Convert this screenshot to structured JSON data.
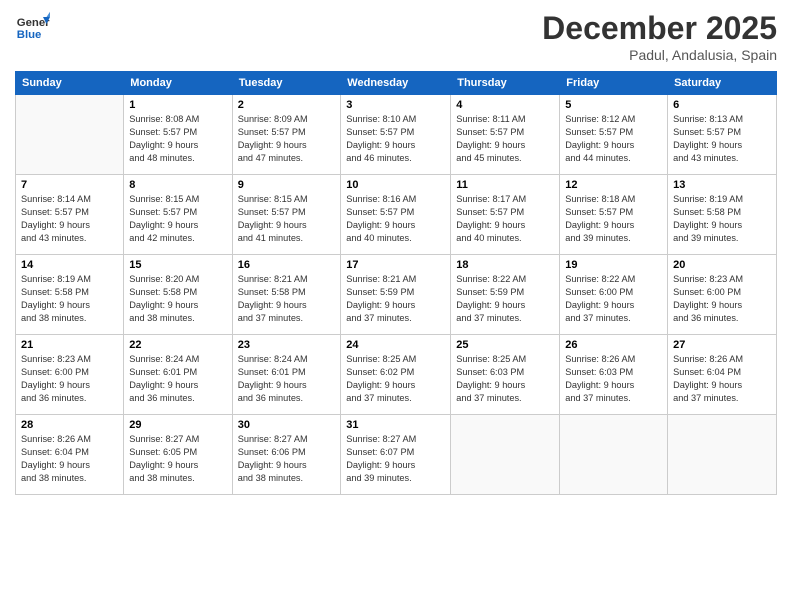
{
  "header": {
    "logo_general": "General",
    "logo_blue": "Blue",
    "month": "December 2025",
    "location": "Padul, Andalusia, Spain"
  },
  "weekdays": [
    "Sunday",
    "Monday",
    "Tuesday",
    "Wednesday",
    "Thursday",
    "Friday",
    "Saturday"
  ],
  "weeks": [
    [
      {
        "day": "",
        "info": ""
      },
      {
        "day": "1",
        "info": "Sunrise: 8:08 AM\nSunset: 5:57 PM\nDaylight: 9 hours\nand 48 minutes."
      },
      {
        "day": "2",
        "info": "Sunrise: 8:09 AM\nSunset: 5:57 PM\nDaylight: 9 hours\nand 47 minutes."
      },
      {
        "day": "3",
        "info": "Sunrise: 8:10 AM\nSunset: 5:57 PM\nDaylight: 9 hours\nand 46 minutes."
      },
      {
        "day": "4",
        "info": "Sunrise: 8:11 AM\nSunset: 5:57 PM\nDaylight: 9 hours\nand 45 minutes."
      },
      {
        "day": "5",
        "info": "Sunrise: 8:12 AM\nSunset: 5:57 PM\nDaylight: 9 hours\nand 44 minutes."
      },
      {
        "day": "6",
        "info": "Sunrise: 8:13 AM\nSunset: 5:57 PM\nDaylight: 9 hours\nand 43 minutes."
      }
    ],
    [
      {
        "day": "7",
        "info": "Sunrise: 8:14 AM\nSunset: 5:57 PM\nDaylight: 9 hours\nand 43 minutes."
      },
      {
        "day": "8",
        "info": "Sunrise: 8:15 AM\nSunset: 5:57 PM\nDaylight: 9 hours\nand 42 minutes."
      },
      {
        "day": "9",
        "info": "Sunrise: 8:15 AM\nSunset: 5:57 PM\nDaylight: 9 hours\nand 41 minutes."
      },
      {
        "day": "10",
        "info": "Sunrise: 8:16 AM\nSunset: 5:57 PM\nDaylight: 9 hours\nand 40 minutes."
      },
      {
        "day": "11",
        "info": "Sunrise: 8:17 AM\nSunset: 5:57 PM\nDaylight: 9 hours\nand 40 minutes."
      },
      {
        "day": "12",
        "info": "Sunrise: 8:18 AM\nSunset: 5:57 PM\nDaylight: 9 hours\nand 39 minutes."
      },
      {
        "day": "13",
        "info": "Sunrise: 8:19 AM\nSunset: 5:58 PM\nDaylight: 9 hours\nand 39 minutes."
      }
    ],
    [
      {
        "day": "14",
        "info": "Sunrise: 8:19 AM\nSunset: 5:58 PM\nDaylight: 9 hours\nand 38 minutes."
      },
      {
        "day": "15",
        "info": "Sunrise: 8:20 AM\nSunset: 5:58 PM\nDaylight: 9 hours\nand 38 minutes."
      },
      {
        "day": "16",
        "info": "Sunrise: 8:21 AM\nSunset: 5:58 PM\nDaylight: 9 hours\nand 37 minutes."
      },
      {
        "day": "17",
        "info": "Sunrise: 8:21 AM\nSunset: 5:59 PM\nDaylight: 9 hours\nand 37 minutes."
      },
      {
        "day": "18",
        "info": "Sunrise: 8:22 AM\nSunset: 5:59 PM\nDaylight: 9 hours\nand 37 minutes."
      },
      {
        "day": "19",
        "info": "Sunrise: 8:22 AM\nSunset: 6:00 PM\nDaylight: 9 hours\nand 37 minutes."
      },
      {
        "day": "20",
        "info": "Sunrise: 8:23 AM\nSunset: 6:00 PM\nDaylight: 9 hours\nand 36 minutes."
      }
    ],
    [
      {
        "day": "21",
        "info": "Sunrise: 8:23 AM\nSunset: 6:00 PM\nDaylight: 9 hours\nand 36 minutes."
      },
      {
        "day": "22",
        "info": "Sunrise: 8:24 AM\nSunset: 6:01 PM\nDaylight: 9 hours\nand 36 minutes."
      },
      {
        "day": "23",
        "info": "Sunrise: 8:24 AM\nSunset: 6:01 PM\nDaylight: 9 hours\nand 36 minutes."
      },
      {
        "day": "24",
        "info": "Sunrise: 8:25 AM\nSunset: 6:02 PM\nDaylight: 9 hours\nand 37 minutes."
      },
      {
        "day": "25",
        "info": "Sunrise: 8:25 AM\nSunset: 6:03 PM\nDaylight: 9 hours\nand 37 minutes."
      },
      {
        "day": "26",
        "info": "Sunrise: 8:26 AM\nSunset: 6:03 PM\nDaylight: 9 hours\nand 37 minutes."
      },
      {
        "day": "27",
        "info": "Sunrise: 8:26 AM\nSunset: 6:04 PM\nDaylight: 9 hours\nand 37 minutes."
      }
    ],
    [
      {
        "day": "28",
        "info": "Sunrise: 8:26 AM\nSunset: 6:04 PM\nDaylight: 9 hours\nand 38 minutes."
      },
      {
        "day": "29",
        "info": "Sunrise: 8:27 AM\nSunset: 6:05 PM\nDaylight: 9 hours\nand 38 minutes."
      },
      {
        "day": "30",
        "info": "Sunrise: 8:27 AM\nSunset: 6:06 PM\nDaylight: 9 hours\nand 38 minutes."
      },
      {
        "day": "31",
        "info": "Sunrise: 8:27 AM\nSunset: 6:07 PM\nDaylight: 9 hours\nand 39 minutes."
      },
      {
        "day": "",
        "info": ""
      },
      {
        "day": "",
        "info": ""
      },
      {
        "day": "",
        "info": ""
      }
    ]
  ]
}
